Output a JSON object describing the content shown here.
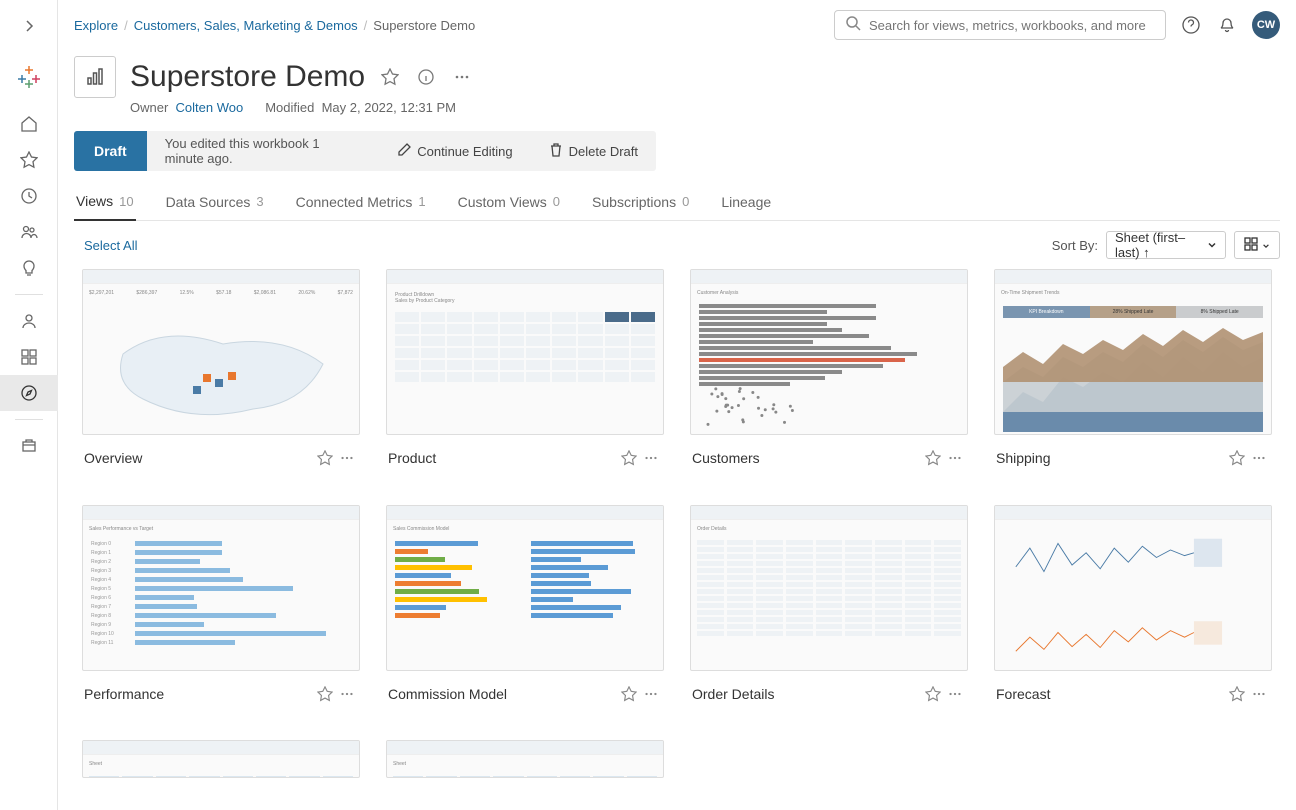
{
  "breadcrumb": {
    "root": "Explore",
    "project": "Customers, Sales, Marketing & Demos",
    "current": "Superstore Demo"
  },
  "search": {
    "placeholder": "Search for views, metrics, workbooks, and more"
  },
  "avatar": {
    "initials": "CW"
  },
  "header": {
    "title": "Superstore Demo",
    "owner_label": "Owner",
    "owner_name": "Colten Woo",
    "modified_label": "Modified",
    "modified_value": "May 2, 2022, 12:31 PM"
  },
  "draft": {
    "chip": "Draft",
    "message": "You edited this workbook 1 minute ago.",
    "continue": "Continue Editing",
    "delete": "Delete Draft"
  },
  "tabs": [
    {
      "label": "Views",
      "count": "10"
    },
    {
      "label": "Data Sources",
      "count": "3"
    },
    {
      "label": "Connected Metrics",
      "count": "1"
    },
    {
      "label": "Custom Views",
      "count": "0"
    },
    {
      "label": "Subscriptions",
      "count": "0"
    },
    {
      "label": "Lineage",
      "count": ""
    }
  ],
  "toolbar": {
    "select_all": "Select All",
    "sort_label": "Sort By:",
    "sort_value": "Sheet (first–last) ↑"
  },
  "views": [
    {
      "title": "Overview"
    },
    {
      "title": "Product"
    },
    {
      "title": "Customers"
    },
    {
      "title": "Shipping"
    },
    {
      "title": "Performance"
    },
    {
      "title": "Commission Model"
    },
    {
      "title": "Order Details"
    },
    {
      "title": "Forecast"
    },
    {
      "title": ""
    },
    {
      "title": ""
    }
  ]
}
